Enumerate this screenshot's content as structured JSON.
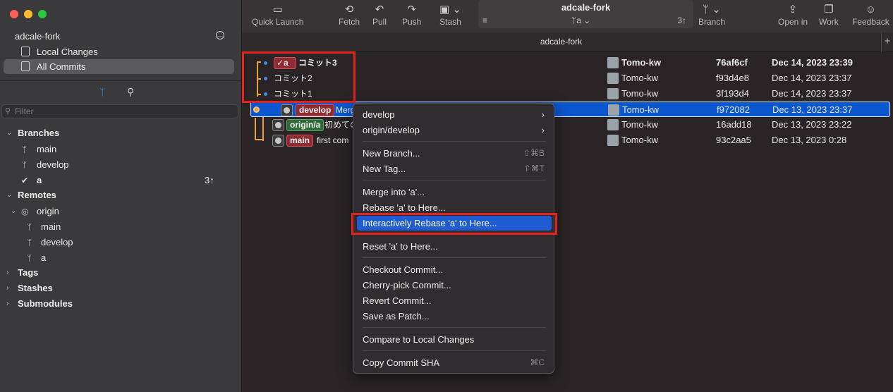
{
  "sidebar": {
    "repo": "adcale-fork",
    "nav": [
      "Local Changes",
      "All Commits"
    ],
    "filter_placeholder": "Filter",
    "branches_header": "Branches",
    "branches": [
      "main",
      "develop",
      "a"
    ],
    "branch_a_count": "3↑",
    "remotes_header": "Remotes",
    "remote_name": "origin",
    "remote_branches": [
      "main",
      "develop",
      "a"
    ],
    "tags_header": "Tags",
    "stashes_header": "Stashes",
    "submodules_header": "Submodules"
  },
  "toolbar": {
    "quick_launch": "Quick Launch",
    "fetch": "Fetch",
    "pull": "Pull",
    "push": "Push",
    "stash": "Stash",
    "repo_title": "adcale-fork",
    "current_branch": "a",
    "ahead": "3↑",
    "branch": "Branch",
    "open_in": "Open in",
    "work": "Work",
    "feedback": "Feedback"
  },
  "tab": {
    "label": "adcale-fork",
    "plus": "+"
  },
  "commits": [
    {
      "branch": "a",
      "message": "コミット3",
      "author": "Tomo-kw",
      "sha": "76af6cf",
      "date": "Dec 14, 2023 23:39"
    },
    {
      "message": "コミット2",
      "author": "Tomo-kw",
      "sha": "f93d4e8",
      "date": "Dec 14, 2023 23:37"
    },
    {
      "message": "コミット1",
      "author": "Tomo-kw",
      "sha": "3f193d4",
      "date": "Dec 14, 2023 23:37"
    },
    {
      "branch": "develop",
      "message": "Merg",
      "author": "Tomo-kw",
      "sha": "f972082",
      "date": "Dec 13, 2023 23:37"
    },
    {
      "branch": "origin/a",
      "message": "初めての",
      "author": "Tomo-kw",
      "sha": "16add18",
      "date": "Dec 13, 2023 23:22"
    },
    {
      "branch": "main",
      "message": "first com",
      "author": "Tomo-kw",
      "sha": "93c2aa5",
      "date": "Dec 13, 2023 0:28"
    }
  ],
  "menu": {
    "develop": "develop",
    "origin_develop": "origin/develop",
    "new_branch": "New Branch...",
    "new_branch_sc": "⇧⌘B",
    "new_tag": "New Tag...",
    "new_tag_sc": "⇧⌘T",
    "merge": "Merge into 'a'...",
    "rebase": "Rebase 'a' to Here...",
    "interactive_rebase": "Interactively Rebase 'a' to Here...",
    "reset": "Reset 'a' to Here...",
    "checkout": "Checkout Commit...",
    "cherry_pick": "Cherry-pick Commit...",
    "revert": "Revert Commit...",
    "save_patch": "Save as Patch...",
    "compare": "Compare to Local Changes",
    "copy_sha": "Copy Commit SHA",
    "copy_sha_sc": "⌘C"
  }
}
